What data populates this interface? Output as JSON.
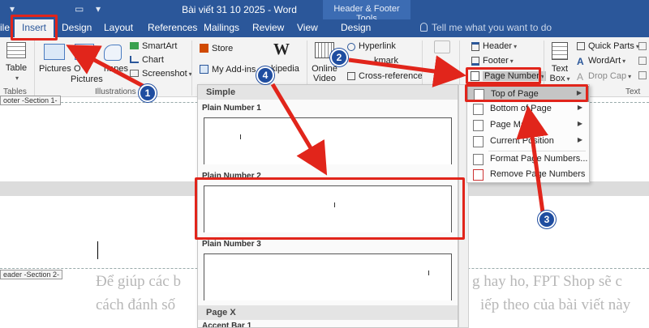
{
  "titlebar": {
    "doc_title": "Bài viết 31 10 2025 - Word",
    "context_group": "Header & Footer Tools"
  },
  "tabs": {
    "file_partial": "ile",
    "insert": "Insert",
    "design": "Design",
    "layout": "Layout",
    "references": "References",
    "mailings": "Mailings",
    "review": "Review",
    "view": "View",
    "hf_design": "Design",
    "tell_me": "Tell me what you want to do"
  },
  "ribbon": {
    "table": "Table",
    "pictures": "Pictures",
    "online_pictures_partial": "O",
    "online_pictures_2": "Pictures",
    "shapes_partial": "hapes",
    "smartart": "SmartArt",
    "chart": "Chart",
    "screenshot": "Screenshot",
    "store": "Store",
    "my_addins": "My Add-ins",
    "wikipedia_partial": "kipedia",
    "online_video_1": "Online",
    "online_video_2": "Video",
    "hyperlink": "Hyperlink",
    "bookmark_partial": "kmark",
    "cross_reference": "Cross-reference",
    "header": "Header",
    "footer": "Footer",
    "page_number": "Page Number",
    "text_box_1": "Text",
    "text_box_2": "Box",
    "quick_parts": "Quick Parts",
    "wordart": "WordArt",
    "drop_cap": "Drop Cap",
    "groups": {
      "tables": "Tables",
      "illustrations": "Illustrations",
      "text": "Text"
    }
  },
  "document": {
    "footer_section_tag": "ooter -Section 1-",
    "header_section_tag": "eader -Section 2-",
    "body_line_1_left": "Để giúp các b",
    "body_line_1_right": "g hay ho, FPT Shop sẽ c",
    "body_line_2_left": "cách đánh số",
    "body_line_2_right": "iếp theo của bài viết này"
  },
  "gallery": {
    "section_simple": "Simple",
    "plain_number_1": "Plain Number 1",
    "plain_number_2": "Plain Number 2",
    "plain_number_3": "Plain Number 3",
    "section_page_x": "Page X",
    "accent_bar_1": "Accent Bar 1"
  },
  "page_number_menu": {
    "top_of_page": "Top of Page",
    "bottom_of_page": "Bottom of Page",
    "page_margins": "Page Ma",
    "current_position": "Current Position",
    "format_page_numbers": "Format Page Numbers...",
    "remove_page_numbers": "Remove Page Numbers"
  },
  "annotations": {
    "step_1": "1",
    "step_2": "2",
    "step_3": "3",
    "step_4": "4",
    "highlight_color": "#e1251b",
    "badge_color": "#1f4da0"
  },
  "colors": {
    "word_blue": "#2b579a",
    "context_tab": "#3c6cb3",
    "ribbon_bg": "#f3f3f3"
  }
}
